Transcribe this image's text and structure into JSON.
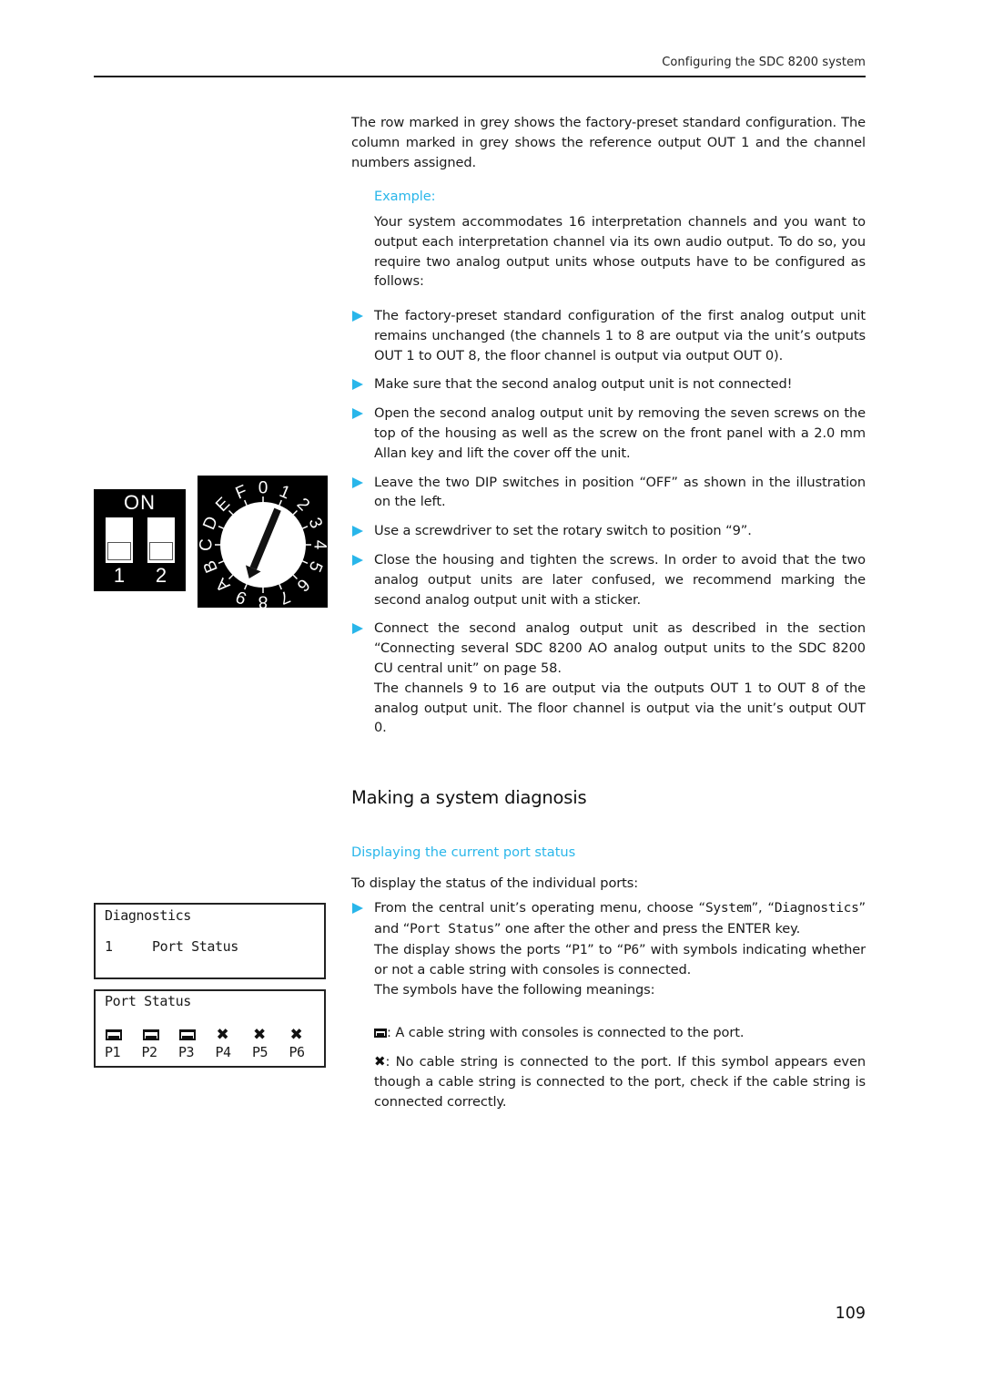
{
  "header": {
    "running_title": "Configuring the SDC 8200 system"
  },
  "intro": {
    "paragraph": "The row marked in grey shows the factory-preset standard configuration. The column marked in grey shows the reference output OUT 1 and the channel numbers assigned."
  },
  "example": {
    "label": "Example:",
    "paragraph": "Your system accommodates 16 interpretation channels and you want to output each interpretation channel via its own audio output. To do so, you require two analog output units whose outputs have to be configured as follows:"
  },
  "steps": [
    {
      "text": "The factory-preset standard configuration of the first analog output unit remains unchanged (the channels 1 to 8 are output via the unit’s outputs OUT 1 to OUT 8, the floor channel is output via output OUT 0)."
    },
    {
      "text": "Make sure that the second analog output unit is not connected!"
    },
    {
      "text": "Open the second analog output unit by removing the seven screws on the top of the housing as well as the screw on the front panel with a 2.0 mm Allan key and lift the cover off the unit."
    },
    {
      "text": "Leave the two DIP switches in position “OFF” as shown in the illustration on the left."
    },
    {
      "text": "Use a screwdriver to set the rotary switch to position “9”."
    },
    {
      "text": "Close the housing and tighten the screws. In order to avoid that the two analog output units are later confused, we recommend marking the second analog output unit with a sticker."
    },
    {
      "text": "Connect the second analog output unit as described in the section “Connecting several SDC 8200 AO analog output units to the SDC 8200 CU central unit” on page 58.",
      "followup": "The channels 9 to 16 are output via the outputs OUT 1 to OUT 8 of the analog output unit. The floor channel is output via the unit’s output OUT 0."
    }
  ],
  "dip_switch": {
    "label_on": "ON",
    "switches": [
      {
        "label": "1",
        "state": "OFF"
      },
      {
        "label": "2",
        "state": "OFF"
      }
    ]
  },
  "rotary_switch": {
    "positions": [
      "0",
      "1",
      "2",
      "3",
      "4",
      "5",
      "6",
      "7",
      "8",
      "9",
      "A",
      "B",
      "C",
      "D",
      "E",
      "F"
    ],
    "selected": "9"
  },
  "section": {
    "title": "Making a system diagnosis",
    "subtitle": "Displaying the current port status",
    "lead": "To display the status of the individual ports:",
    "step": {
      "t1": "From the central unit’s operating menu, choose “",
      "menu1": "System",
      "t2": "”, “",
      "menu2": "Diagnostics",
      "t3": "” and “",
      "menu3": "Port Status",
      "t4": "” one after the other and press the ENTER key.",
      "line2a": "The display shows the ports “",
      "p1": "P1",
      "line2b": "” to “",
      "p6": "P6",
      "line2c": "” with symbols indicating whether or not a cable string with consoles is connected.",
      "line3": "The symbols have the following meanings:"
    },
    "legend": [
      {
        "symbol": "connected-icon",
        "text": ": A cable string with consoles is connected to the port."
      },
      {
        "symbol": "not-connected-icon",
        "text": ": No cable string is connected to the port. If this symbol appears even though a cable string is connected to the port, check if the cable string is connected correctly."
      }
    ]
  },
  "lcd_diagnostics": {
    "title": "Diagnostics",
    "item_number": "1",
    "item_label": "Port Status"
  },
  "lcd_port_status": {
    "title": "Port Status",
    "ports": [
      {
        "label": "P1",
        "status": "connected"
      },
      {
        "label": "P2",
        "status": "connected"
      },
      {
        "label": "P3",
        "status": "connected"
      },
      {
        "label": "P4",
        "status": "not-connected"
      },
      {
        "label": "P5",
        "status": "not-connected"
      },
      {
        "label": "P6",
        "status": "not-connected"
      }
    ]
  },
  "colors": {
    "accent": "#29b6ea",
    "text": "#1a1a1a"
  },
  "footer": {
    "page_number": "109"
  }
}
